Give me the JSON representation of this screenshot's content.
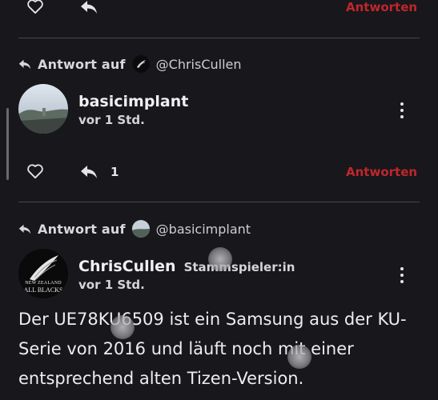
{
  "post_top": {
    "reply_button_label": "Antworten"
  },
  "post_reply_1": {
    "reply_to_label": "Antwort auf",
    "reply_to_handle": "@ChrisCullen",
    "username": "basicimplant",
    "time": "vor 1 Std.",
    "reply_count": "1",
    "reply_button_label": "Antworten"
  },
  "post_reply_2": {
    "reply_to_label": "Antwort auf",
    "reply_to_handle": "@basicimplant",
    "username": "ChrisCullen",
    "user_title": "Stammspieler:in",
    "time": "vor 1 Std.",
    "avatar_text_1": "NEW ZEALAND",
    "avatar_text_2": "ALL BLACKS",
    "body": "Der UE78KU6509 ist ein Samsung aus der KU-Serie von 2016 und läuft noch mit einer entsprechend alten Tizen-Version."
  },
  "colors": {
    "background": "#18171b",
    "accent_red": "#c0262d",
    "divider": "#4b494f"
  }
}
